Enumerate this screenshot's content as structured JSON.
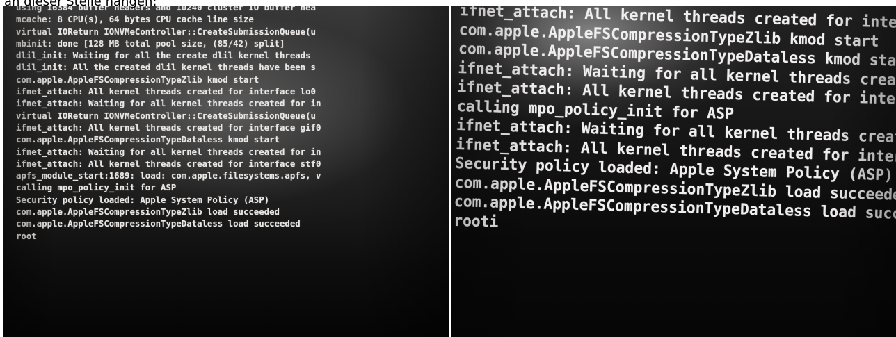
{
  "caption": "an dieser Stelle hängen:",
  "left_photo": {
    "lines": [
      "using 16384 buffer headers and 10240 cluster IO buffer hea",
      "mcache: 8 CPU(s), 64 bytes CPU cache line size",
      "virtual IOReturn IONVMeController::CreateSubmissionQueue(u",
      "mbinit: done [128 MB total pool size, (85/42) split]",
      "dlil_init: Waiting for all the create dlil kernel threads",
      "dlil_init: All the created dlil kernel threads have been s",
      "com.apple.AppleFSCompressionTypeZlib kmod start",
      "ifnet_attach: All kernel threads created for interface lo0",
      "ifnet_attach: Waiting for all kernel threads created for in",
      "virtual IOReturn IONVMeController::CreateSubmissionQueue(u",
      "ifnet_attach: All kernel threads created for interface gif0",
      "com.apple.AppleFSCompressionTypeDataless kmod start",
      "ifnet_attach: Waiting for all kernel threads created for in",
      "ifnet_attach: All kernel threads created for interface stf0",
      "apfs_module_start:1689: load: com.apple.filesystems.apfs, v",
      "calling mpo_policy_init for ASP",
      "Security policy loaded: Apple System Policy (ASP)",
      "com.apple.AppleFSCompressionTypeZlib load succeeded",
      "com.apple.AppleFSCompressionTypeDataless load succeeded",
      "root"
    ]
  },
  "right_photo": {
    "lines": [
      "ifnet_attach: All kernel threads created for interface",
      "com.apple.AppleFSCompressionTypeZlib kmod start",
      "com.apple.AppleFSCompressionTypeDataless kmod start",
      "ifnet_attach: Waiting for all kernel threads created",
      "ifnet_attach: All kernel threads created for interface",
      "calling mpo_policy_init for ASP",
      "ifnet_attach: Waiting for all kernel threads created",
      "ifnet_attach: All kernel threads created for interface",
      "Security policy loaded: Apple System Policy (ASP)",
      "com.apple.AppleFSCompressionTypeZlib load succeeded",
      "com.apple.AppleFSCompressionTypeDataless load succeeded",
      "rooti"
    ]
  },
  "colors": {
    "console_text": "#e9e6e3",
    "screen_background": "#050505",
    "page_background": "#ffffff"
  }
}
